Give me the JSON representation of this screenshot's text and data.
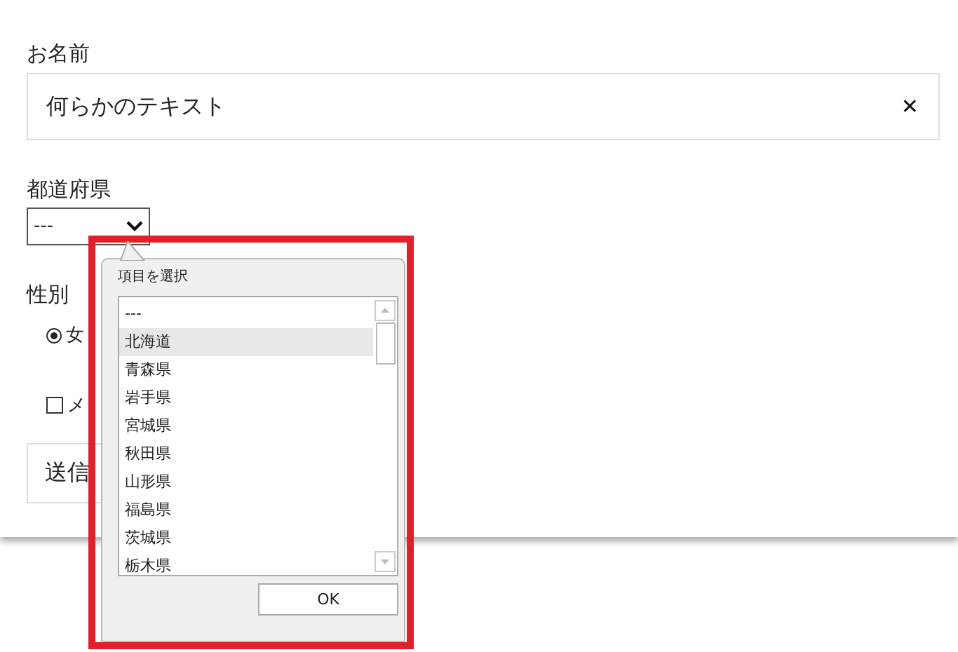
{
  "form": {
    "name_label": "お名前",
    "name_value": "何らかのテキスト",
    "clear_glyph": "✕",
    "prefecture_label": "都道府県",
    "prefecture_value": "---",
    "gender_label": "性別",
    "gender_option": {
      "label": "女",
      "selected": true
    },
    "checkbox": {
      "label": "メ",
      "checked": false
    },
    "submit": "送信"
  },
  "picker": {
    "title": "項目を選択",
    "options": [
      {
        "label": "---",
        "selected": false
      },
      {
        "label": "北海道",
        "selected": true
      },
      {
        "label": "青森県",
        "selected": false
      },
      {
        "label": "岩手県",
        "selected": false
      },
      {
        "label": "宮城県",
        "selected": false
      },
      {
        "label": "秋田県",
        "selected": false
      },
      {
        "label": "山形県",
        "selected": false
      },
      {
        "label": "福島県",
        "selected": false
      },
      {
        "label": "茨城県",
        "selected": false
      },
      {
        "label": "栃木県",
        "selected": false
      }
    ],
    "ok": "OK"
  }
}
